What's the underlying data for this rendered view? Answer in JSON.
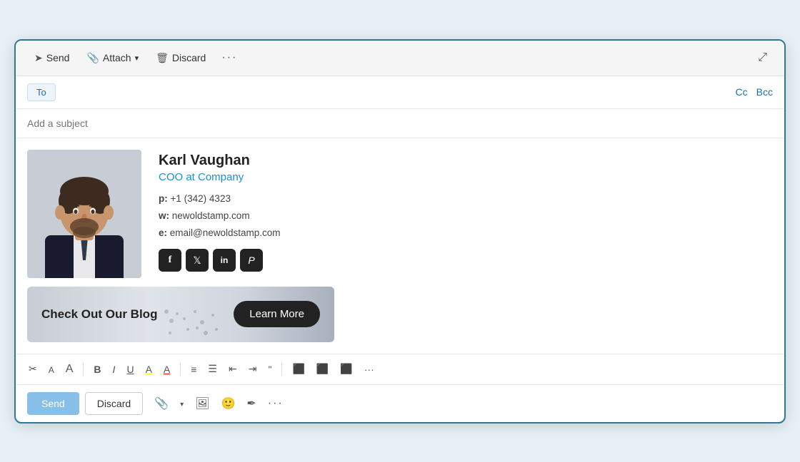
{
  "toolbar": {
    "send_label": "Send",
    "attach_label": "Attach",
    "discard_label": "Discard",
    "more_label": "···"
  },
  "compose": {
    "to_label": "To",
    "to_placeholder": "",
    "cc_label": "Cc",
    "bcc_label": "Bcc",
    "subject_placeholder": "Add a subject"
  },
  "signature": {
    "name": "Karl Vaughan",
    "title": "COO at Company",
    "phone_label": "p:",
    "phone": "+1 (342) 4323",
    "web_label": "w:",
    "web": "newoldstamp.com",
    "email_label": "e:",
    "email": "email@newoldstamp.com",
    "socials": [
      "f",
      "t",
      "in",
      "p"
    ]
  },
  "banner": {
    "text": "Check Out Our Blog",
    "button_label": "Learn More"
  },
  "format_bar": {
    "bold": "B",
    "italic": "I",
    "underline": "U"
  },
  "bottom": {
    "send_label": "Send",
    "discard_label": "Discard"
  }
}
